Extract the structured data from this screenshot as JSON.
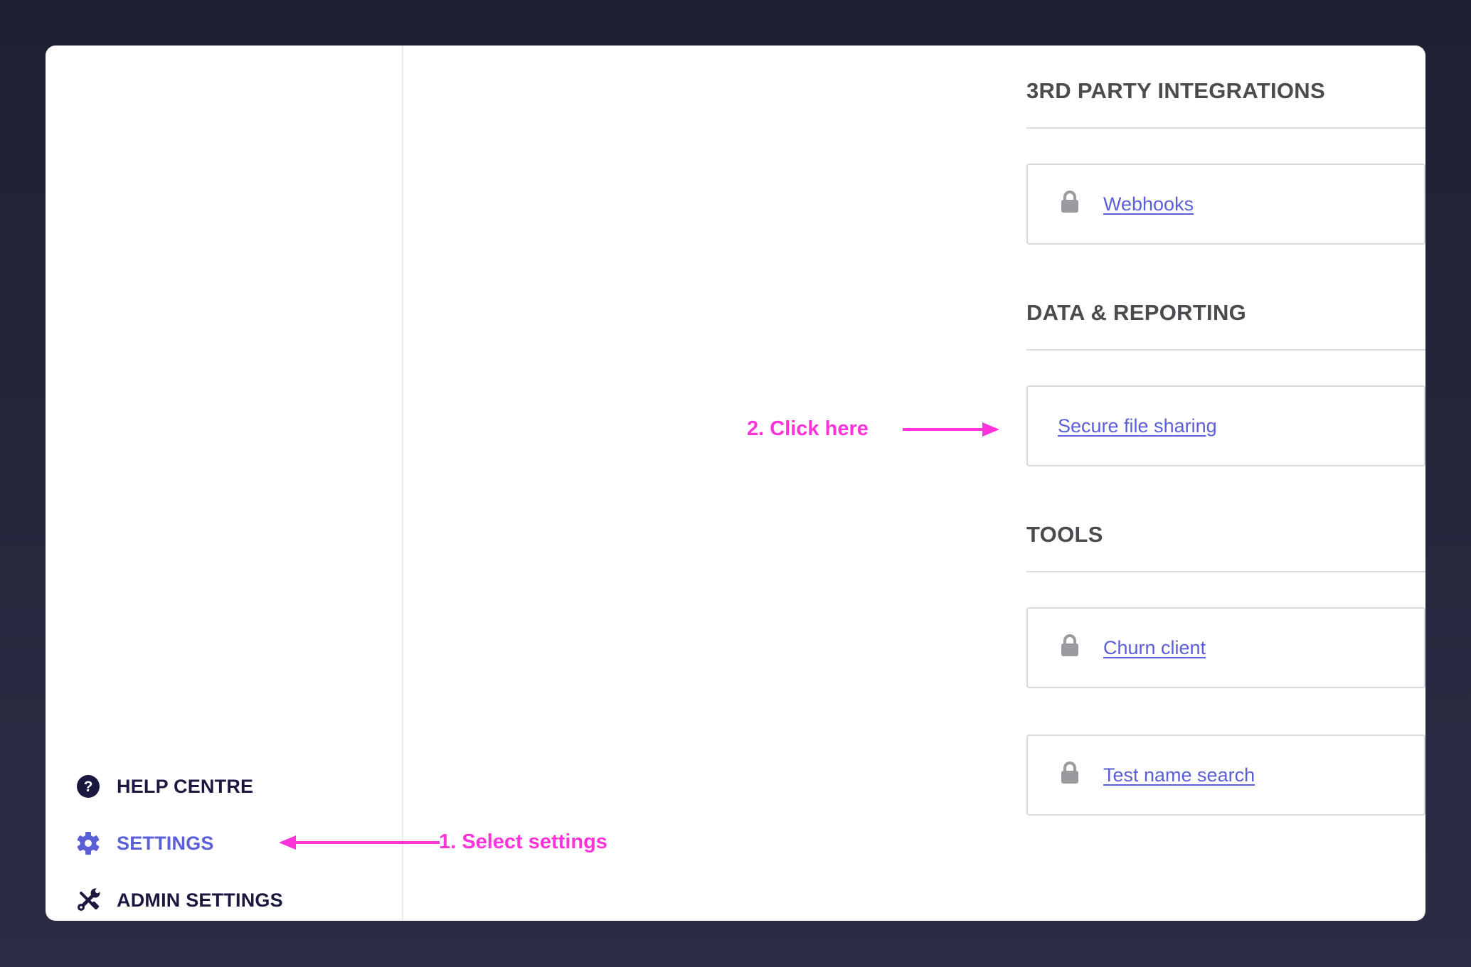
{
  "sidebar": {
    "items": [
      {
        "label": "HELP CENTRE",
        "icon": "help-icon"
      },
      {
        "label": "SETTINGS",
        "icon": "gear-icon",
        "active": true
      },
      {
        "label": "ADMIN SETTINGS",
        "icon": "tools-icon"
      }
    ]
  },
  "sections": [
    {
      "title": "3RD PARTY INTEGRATIONS",
      "cards": [
        {
          "label": "Webhooks",
          "locked": true
        }
      ]
    },
    {
      "title": "DATA & REPORTING",
      "cards": [
        {
          "label": "Secure file sharing",
          "locked": false
        }
      ]
    },
    {
      "title": "TOOLS",
      "cards": [
        {
          "label": "Churn client",
          "locked": true
        },
        {
          "label": "Test name search",
          "locked": true
        }
      ]
    }
  ],
  "annotations": {
    "step1": "1. Select settings",
    "step2": "2. Click here"
  },
  "colors": {
    "background": "#1e2034",
    "accent": "#5a5fd8",
    "nav_text": "#1b1840",
    "annotation": "#ff33d9",
    "lock": "#9b9b9f"
  }
}
